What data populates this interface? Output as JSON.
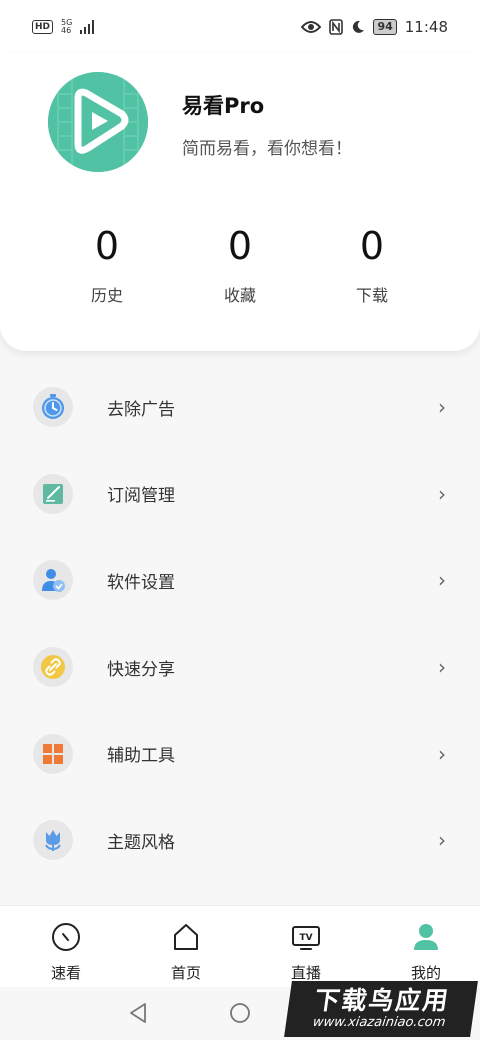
{
  "status_bar": {
    "hd": "HD",
    "net_top": "5G",
    "net_bottom": "46",
    "battery": "94",
    "time": "11:48"
  },
  "profile": {
    "app_name": "易看Pro",
    "slogan": "简而易看，看你想看！",
    "logo_icon": "yikan-play-logo",
    "brand_color": "#52c2a4"
  },
  "stats": [
    {
      "value": "0",
      "label": "历史"
    },
    {
      "value": "0",
      "label": "收藏"
    },
    {
      "value": "0",
      "label": "下载"
    }
  ],
  "menu": [
    {
      "label": "去除广告",
      "icon": "clock-icon"
    },
    {
      "label": "订阅管理",
      "icon": "subscription-icon"
    },
    {
      "label": "软件设置",
      "icon": "user-settings-icon"
    },
    {
      "label": "快速分享",
      "icon": "link-icon"
    },
    {
      "label": "辅助工具",
      "icon": "grid-tools-icon"
    },
    {
      "label": "主题风格",
      "icon": "tulip-icon"
    }
  ],
  "chevron": "›",
  "bottom_nav": [
    {
      "label": "速看",
      "icon": "speedometer-icon"
    },
    {
      "label": "首页",
      "icon": "home-icon"
    },
    {
      "label": "直播",
      "icon": "tv-icon"
    },
    {
      "label": "我的",
      "icon": "profile-icon",
      "active_color": "#52c2a4"
    }
  ],
  "watermark": {
    "title": "下载鸟应用",
    "url": "www.xiazainiao.com"
  }
}
